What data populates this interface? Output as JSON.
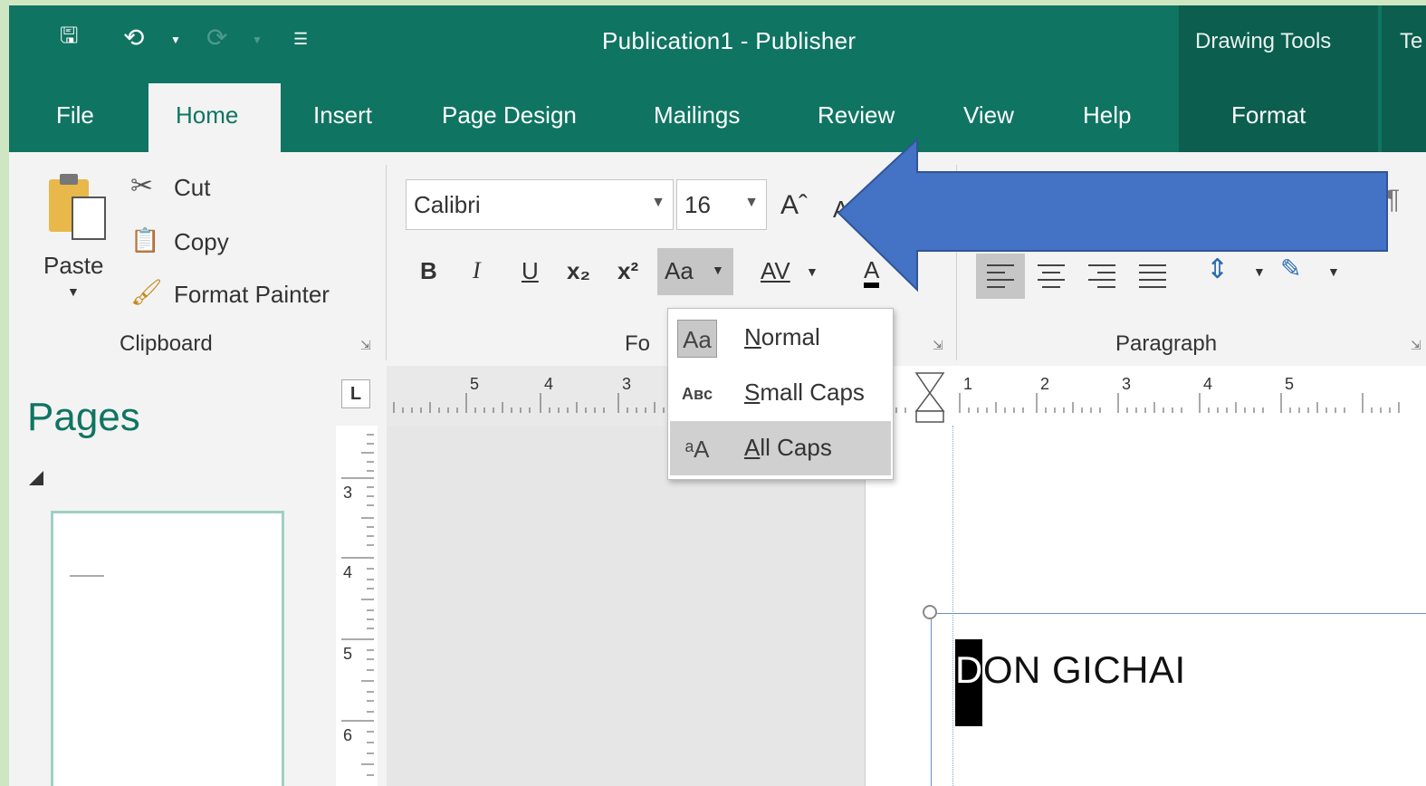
{
  "window": {
    "title": "Publication1  -  Publisher",
    "context_tab_1": "Drawing Tools",
    "context_tab_2": "Te"
  },
  "tabs": [
    "File",
    "Home",
    "Insert",
    "Page Design",
    "Mailings",
    "Review",
    "View",
    "Help",
    "Format"
  ],
  "clipboard": {
    "paste": "Paste",
    "cut": "Cut",
    "copy": "Copy",
    "format_painter": "Format Painter",
    "group_label": "Clipboard"
  },
  "font": {
    "font_name": "Calibri",
    "font_size": "16",
    "group_label_partial": "Fo",
    "bold": "B",
    "italic": "I",
    "underline": "U",
    "subscript": "x₂",
    "superscript": "x²",
    "change_case": "Aa",
    "spacing": "AV",
    "font_color": "A"
  },
  "paragraph": {
    "group_label": "Paragraph"
  },
  "case_menu": {
    "items": [
      {
        "icon": "Aa",
        "label": "Normal",
        "accel": "N",
        "rest": "ormal"
      },
      {
        "icon": "Aʙᴄ",
        "label": "Small Caps",
        "accel": "S",
        "rest": "mall Caps"
      },
      {
        "icon": "ᵃA",
        "label": "All Caps",
        "accel": "A",
        "rest": "ll Caps",
        "selected": true
      }
    ]
  },
  "pages_panel": {
    "title": "Pages"
  },
  "ruler": {
    "corner": "L",
    "h_left_numbers": [
      "5",
      "4",
      "3"
    ],
    "h_right_numbers": [
      "1",
      "2",
      "3",
      "4",
      "5"
    ],
    "v_numbers": [
      "3",
      "4",
      "5",
      "6"
    ]
  },
  "document": {
    "text": "DON GICHAI",
    "first_letter": "D"
  },
  "colors": {
    "accent": "#0f7562",
    "arrow": "#4472c4"
  }
}
